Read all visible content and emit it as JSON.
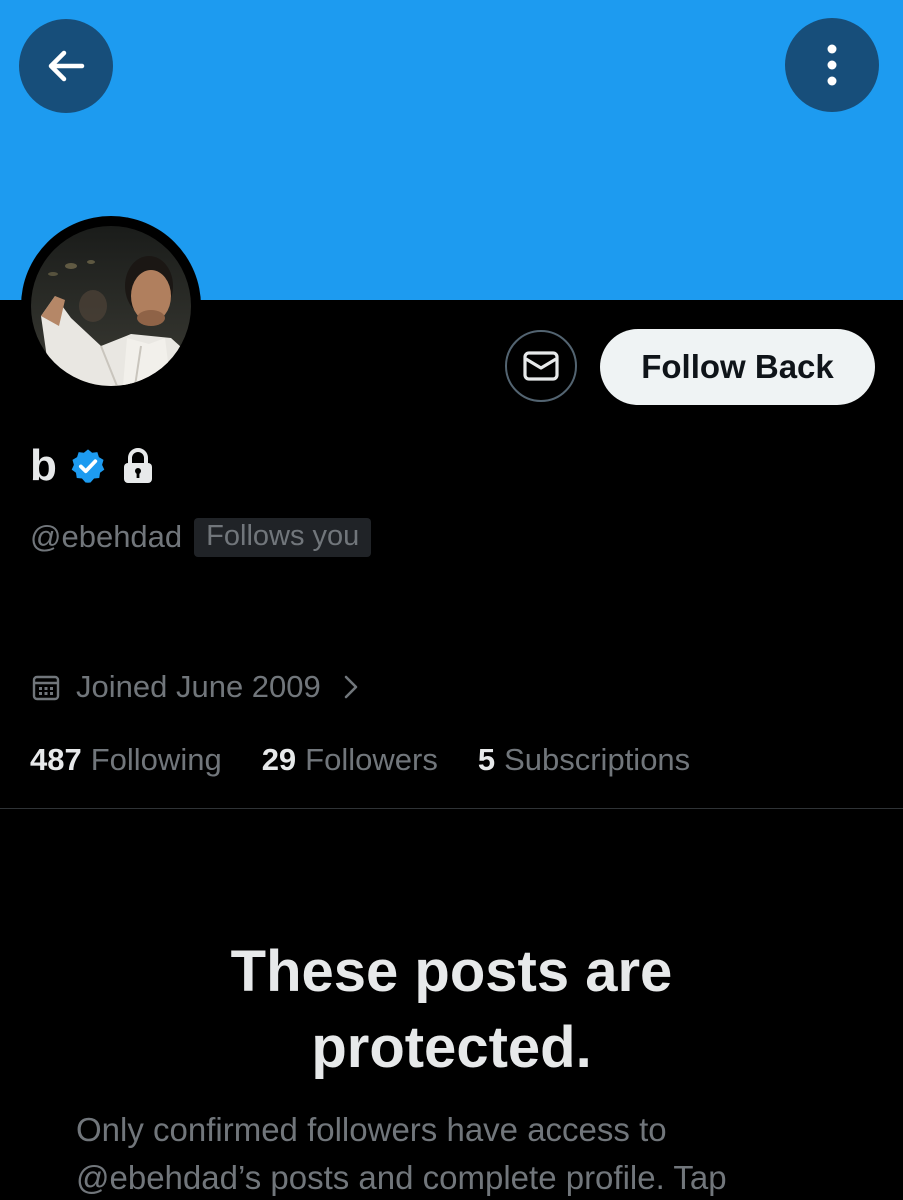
{
  "header": {
    "back_icon": "arrow-left-icon",
    "more_icon": "more-vertical-icon",
    "banner_color": "#1d9bf0"
  },
  "profile": {
    "display_name": "b",
    "verified_icon": "verified-badge-icon",
    "lock_icon": "lock-icon",
    "handle": "@ebehdad",
    "follows_you": "Follows you",
    "joined": "Joined June 2009",
    "calendar_icon": "calendar-icon"
  },
  "actions": {
    "message_icon": "envelope-icon",
    "follow_label": "Follow Back"
  },
  "stats": [
    {
      "count": "487",
      "label": "Following"
    },
    {
      "count": "29",
      "label": "Followers"
    },
    {
      "count": "5",
      "label": "Subscriptions"
    }
  ],
  "protected": {
    "title": "These posts are protected.",
    "body": "Only confirmed followers have access to @ebehdad’s posts and complete profile. Tap"
  },
  "colors": {
    "accent": "#1d9bf0",
    "background": "#000000",
    "text_primary": "#e7e9ea",
    "text_secondary": "#71767b"
  }
}
